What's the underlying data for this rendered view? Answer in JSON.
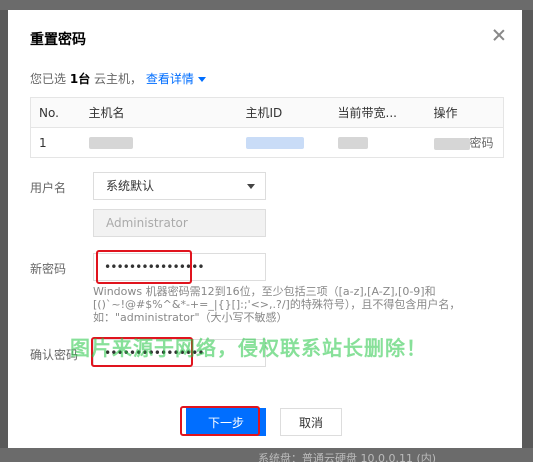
{
  "dialog": {
    "title": "重置密码",
    "selected_prefix": "您已选",
    "selected_count": "1台",
    "selected_suffix": "云主机，",
    "details_link": "查看详情"
  },
  "table": {
    "headers": [
      "No.",
      "主机名",
      "主机ID",
      "当前带宽...",
      "操作"
    ],
    "rows": [
      {
        "no": "1",
        "action_suffix": "密码"
      }
    ]
  },
  "form": {
    "username_label": "用户名",
    "username_select_value": "系统默认",
    "username_disabled_value": "Administrator",
    "new_password_label": "新密码",
    "new_password_value": "••••••••••••••••",
    "password_hint": "Windows 机器密码需12到16位，至少包括三项（[a-z],[A-Z],[0-9]和[()`~!@#$%^&*-+=_|{}[]:;'<>,.?/]的特殊符号），且不得包含用户名，如：\"administrator\"（大小写不敏感）",
    "confirm_password_label": "确认密码",
    "confirm_password_value": "••••••••••••••••"
  },
  "buttons": {
    "next": "下一步",
    "cancel": "取消"
  },
  "watermark": "图片来源于网络，侵权联系站长删除！",
  "backdrop_bottom_text": "系统盘：普通云硬盘     10.0.0.11 (内)",
  "colors": {
    "primary": "#006eff",
    "highlight_red": "#e0141e",
    "watermark_green": "#24c646"
  }
}
